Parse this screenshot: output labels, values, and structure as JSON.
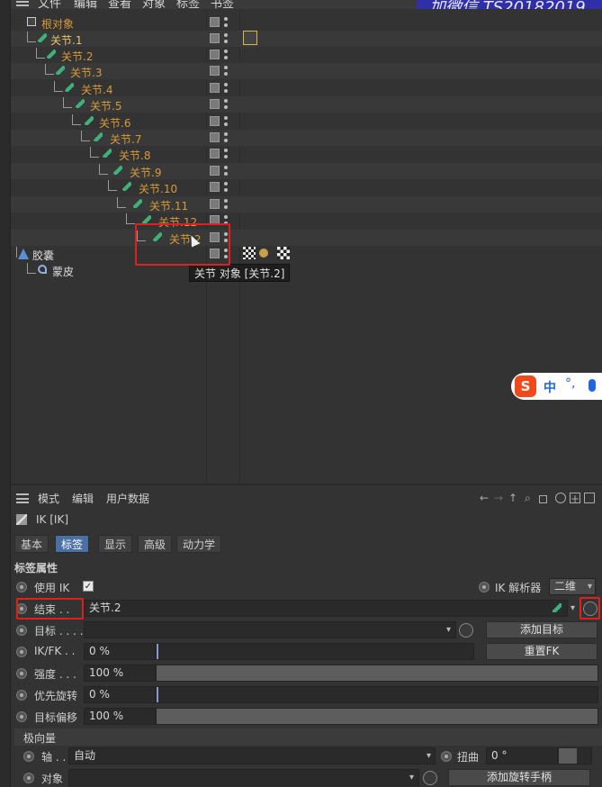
{
  "top_menu": {
    "items": [
      "文件",
      "编辑",
      "查看",
      "对象",
      "标签",
      "书签"
    ]
  },
  "watermark": "加微信  TS20182019",
  "objects": [
    {
      "label": "根对象"
    },
    {
      "label": "关节.1"
    },
    {
      "label": "关节.2"
    },
    {
      "label": "关节.3"
    },
    {
      "label": "关节.4"
    },
    {
      "label": "关节.5"
    },
    {
      "label": "关节.6"
    },
    {
      "label": "关节.7"
    },
    {
      "label": "关节.8"
    },
    {
      "label": "关节.9"
    },
    {
      "label": "关节.10"
    },
    {
      "label": "关节.11"
    },
    {
      "label": "关节.12"
    },
    {
      "label": "关节.2"
    },
    {
      "label": "胶囊"
    },
    {
      "label": "蒙皮"
    }
  ],
  "tooltip": "关节 对象 [关节.2]",
  "ime": {
    "zh": "中",
    "punc": "°,"
  },
  "attr_menu": {
    "items": [
      "模式",
      "编辑",
      "用户数据"
    ]
  },
  "tag_title": "IK [IK]",
  "tabs": [
    "基本",
    "标签",
    "显示",
    "高级",
    "动力学"
  ],
  "section_title": "标签属性",
  "fields": {
    "use_ik_label": "使用 IK",
    "use_ik_checked": "✓",
    "ik_solver_label": "IK 解析器",
    "ik_solver_value": "二维",
    "end_label": "结束 . .",
    "end_value": "关节.2",
    "target_label": "目标 . . . .",
    "target_value": "",
    "add_target_button": "添加目标",
    "ikfk_label": "IK/FK . .",
    "ikfk_value": "0 %",
    "ikfk_fraction": 0.0,
    "reset_fk_button": "重置FK",
    "strength_label": "强度 . . .",
    "strength_value": "100 %",
    "strength_fraction": 1.0,
    "priority_label": "优先旋转",
    "priority_value": "0 %",
    "priority_fraction": 0.0,
    "offset_label": "目标偏移",
    "offset_value": "100 %",
    "offset_fraction": 1.0
  },
  "pole": {
    "section": "极向量",
    "axis_label": "轴 . .",
    "axis_value": "自动",
    "twist_label": "扭曲",
    "twist_value": "0 °",
    "object_label": "对象",
    "object_value": "",
    "add_handle_button": "添加旋转手柄"
  },
  "colors": {
    "accent": "#4a6fa5",
    "highlight": "#e0201c",
    "joint_name": "#d79a3a"
  }
}
